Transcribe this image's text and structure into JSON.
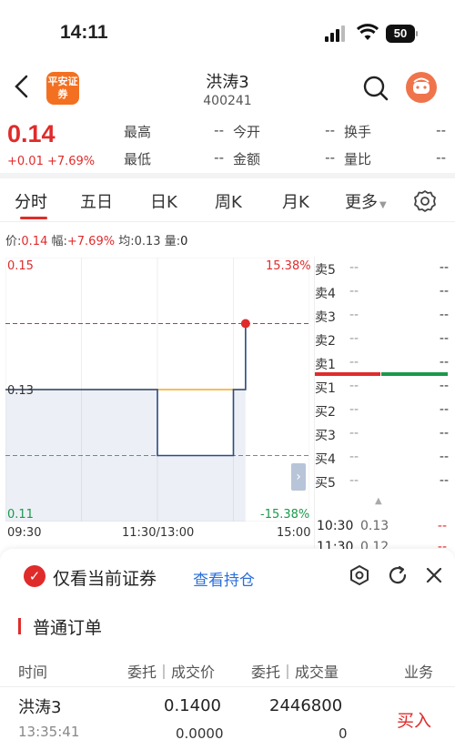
{
  "status_bar": {
    "time": "14:11",
    "battery": "50"
  },
  "header": {
    "title": "洪涛3",
    "code": "400241",
    "logo_text": "平安证券"
  },
  "quote": {
    "price": "0.14",
    "change": "+0.01 +7.69%",
    "fields": [
      {
        "label": "最高",
        "value": "--"
      },
      {
        "label": "今开",
        "value": "--"
      },
      {
        "label": "换手",
        "value": "--"
      },
      {
        "label": "最低",
        "value": "--"
      },
      {
        "label": "金额",
        "value": "--"
      },
      {
        "label": "量比",
        "value": "--"
      }
    ]
  },
  "tabs": [
    {
      "label": "分时"
    },
    {
      "label": "五日"
    },
    {
      "label": "日K"
    },
    {
      "label": "周K"
    },
    {
      "label": "月K"
    },
    {
      "label": "更多"
    }
  ],
  "info_line": {
    "price_label": "价:",
    "price": "0.14",
    "range_label": "幅:",
    "range": "+7.69%",
    "avg_label": "均:",
    "avg": "0.13",
    "vol_label": "量:",
    "vol": "0"
  },
  "chart_axis": {
    "top_price": "0.15",
    "top_pct": "15.38%",
    "mid_price": "0.13",
    "bottom_price": "0.11",
    "bottom_pct": "-15.38%",
    "time_start": "09:30",
    "time_mid": "11:30/13:00",
    "time_end": "15:00"
  },
  "chart_data": {
    "type": "line",
    "x_positions": [
      0,
      0.5,
      0.5,
      0.75,
      0.75,
      0.79,
      0.79
    ],
    "price": [
      0.13,
      0.13,
      0.12,
      0.12,
      0.13,
      0.13,
      0.14
    ],
    "avg": [
      0.13,
      0.13,
      0.13,
      0.13,
      0.13,
      0.13,
      0.13
    ],
    "prev_close": 0.13,
    "last_price": 0.14,
    "low_line": 0.12,
    "ylim": [
      0.11,
      0.15
    ],
    "colors": {
      "price": "#2b4a7e",
      "avg": "#f5a623",
      "last": "#e02b2b",
      "low": "#4a90e2"
    }
  },
  "order_book": {
    "asks": [
      {
        "label": "卖5",
        "price": "--",
        "vol": "--"
      },
      {
        "label": "卖4",
        "price": "--",
        "vol": "--"
      },
      {
        "label": "卖3",
        "price": "--",
        "vol": "--"
      },
      {
        "label": "卖2",
        "price": "--",
        "vol": "--"
      },
      {
        "label": "卖1",
        "price": "--",
        "vol": "--"
      }
    ],
    "bids": [
      {
        "label": "买1",
        "price": "--",
        "vol": "--"
      },
      {
        "label": "买2",
        "price": "--",
        "vol": "--"
      },
      {
        "label": "买3",
        "price": "--",
        "vol": "--"
      },
      {
        "label": "买4",
        "price": "--",
        "vol": "--"
      },
      {
        "label": "买5",
        "price": "--",
        "vol": "--"
      }
    ],
    "ticks": [
      {
        "time": "10:30",
        "price": "0.13",
        "vol": "--"
      },
      {
        "time": "11:30",
        "price": "0.12",
        "vol": "--"
      }
    ]
  },
  "sheet": {
    "only_current": "仅看当前证券",
    "view_holdings": "查看持仓",
    "section_title": "普通订单",
    "headers": {
      "time": "时间",
      "entrust_deal_price": "委托｜成交价",
      "entrust_deal_qty": "委托｜成交量",
      "business": "业务"
    },
    "orders": [
      {
        "name": "洪涛3",
        "time": "13:35:41",
        "entrust_price": "0.1400",
        "deal_price": "0.0000",
        "entrust_qty": "2446800",
        "deal_qty": "0",
        "business": "买入"
      }
    ]
  }
}
